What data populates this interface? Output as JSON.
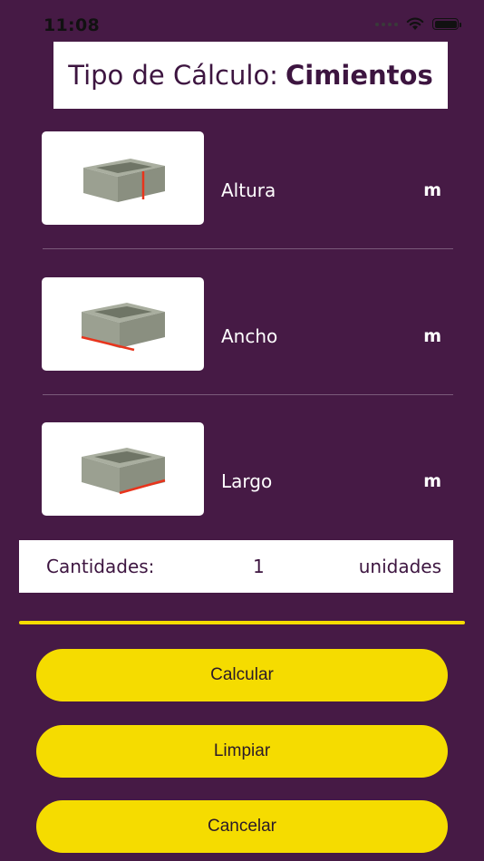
{
  "status_bar": {
    "time": "11:08"
  },
  "title": {
    "prefix": "Tipo de Cálculo:",
    "value": "Cimientos"
  },
  "measurements": [
    {
      "label": "Altura",
      "unit": "m",
      "highlight_edge": "vertical-corner"
    },
    {
      "label": "Ancho",
      "unit": "m",
      "highlight_edge": "bottom-left"
    },
    {
      "label": "Largo",
      "unit": "m",
      "highlight_edge": "bottom-right"
    }
  ],
  "quantity": {
    "label": "Cantidades:",
    "value": "1",
    "unit": "unidades"
  },
  "buttons": {
    "calculate": "Calcular",
    "clear": "Limpiar",
    "cancel": "Cancelar"
  },
  "colors": {
    "background": "#461a45",
    "accent": "#f5dc00",
    "title_text": "#3d1540",
    "edge_highlight": "#e8341c"
  }
}
